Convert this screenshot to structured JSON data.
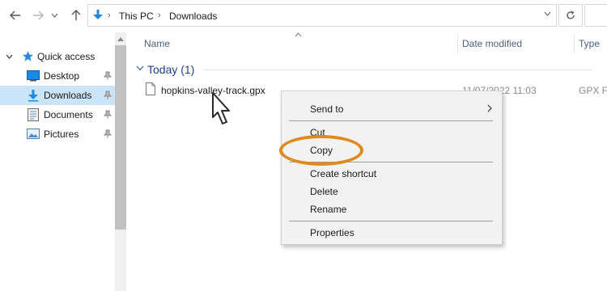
{
  "address": {
    "root": "This PC",
    "current": "Downloads"
  },
  "sidebar": {
    "items": [
      {
        "label": "Quick access",
        "icon": "star-icon"
      },
      {
        "label": "Desktop",
        "icon": "desktop-icon",
        "pinned": true
      },
      {
        "label": "Downloads",
        "icon": "download-icon",
        "pinned": true,
        "selected": true
      },
      {
        "label": "Documents",
        "icon": "documents-icon",
        "pinned": true
      },
      {
        "label": "Pictures",
        "icon": "pictures-icon",
        "pinned": true
      }
    ]
  },
  "columns": {
    "name": "Name",
    "date_modified": "Date modified",
    "type": "Type"
  },
  "group": {
    "label": "Today (1)"
  },
  "file": {
    "name": "hopkins-valley-track.gpx",
    "date": "11/07/2022 11:03",
    "type": "GPX Fi"
  },
  "context_menu": {
    "items": [
      "Send to",
      "Cut",
      "Copy",
      "Create shortcut",
      "Delete",
      "Rename",
      "Properties"
    ],
    "highlighted": "Copy"
  },
  "colors": {
    "accent": "#1e88e5",
    "selection": "#cce4f7",
    "highlight_ring": "#e08a1e",
    "group_label": "#1e3f8a"
  }
}
